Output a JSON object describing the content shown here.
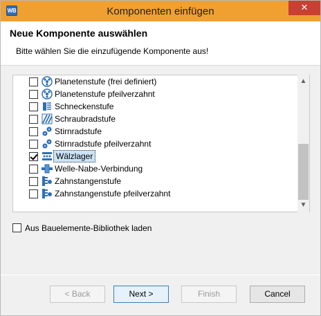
{
  "window": {
    "app_icon": "WB",
    "title": "Komponenten einfügen",
    "close_glyph": "✕"
  },
  "header": {
    "title": "Neue Komponente auswählen",
    "description": "Bitte wählen Sie die einzufügende Komponente aus!"
  },
  "components": [
    {
      "label": "Planetenstufe (frei definiert)",
      "checked": false,
      "icon": "planetary-gear-icon"
    },
    {
      "label": "Planetenstufe pfeilverzahnt",
      "checked": false,
      "icon": "planetary-gear-icon"
    },
    {
      "label": "Schneckenstufe",
      "checked": false,
      "icon": "worm-gear-icon"
    },
    {
      "label": "Schraubradstufe",
      "checked": false,
      "icon": "helical-gear-icon"
    },
    {
      "label": "Stirnradstufe",
      "checked": false,
      "icon": "spur-gear-icon"
    },
    {
      "label": "Stirnradstufe pfeilverzahnt",
      "checked": false,
      "icon": "spur-gear-icon"
    },
    {
      "label": "Wälzlager",
      "checked": true,
      "selected": true,
      "icon": "bearing-icon"
    },
    {
      "label": "Welle-Nabe-Verbindung",
      "checked": false,
      "icon": "shaft-hub-icon"
    },
    {
      "label": "Zahnstangenstufe",
      "checked": false,
      "icon": "rack-gear-icon"
    },
    {
      "label": "Zahnstangenstufe pfeilverzahnt",
      "checked": false,
      "icon": "rack-gear-icon"
    }
  ],
  "library": {
    "label": "Aus Bauelemente-Bibliothek laden",
    "checked": false
  },
  "buttons": {
    "back": "< Back",
    "next": "Next >",
    "finish": "Finish",
    "cancel": "Cancel"
  },
  "colors": {
    "titlebar": "#f0a030",
    "close_button": "#c84031",
    "icon_blue": "#2e6fb8",
    "selection": "#cce4f7"
  }
}
